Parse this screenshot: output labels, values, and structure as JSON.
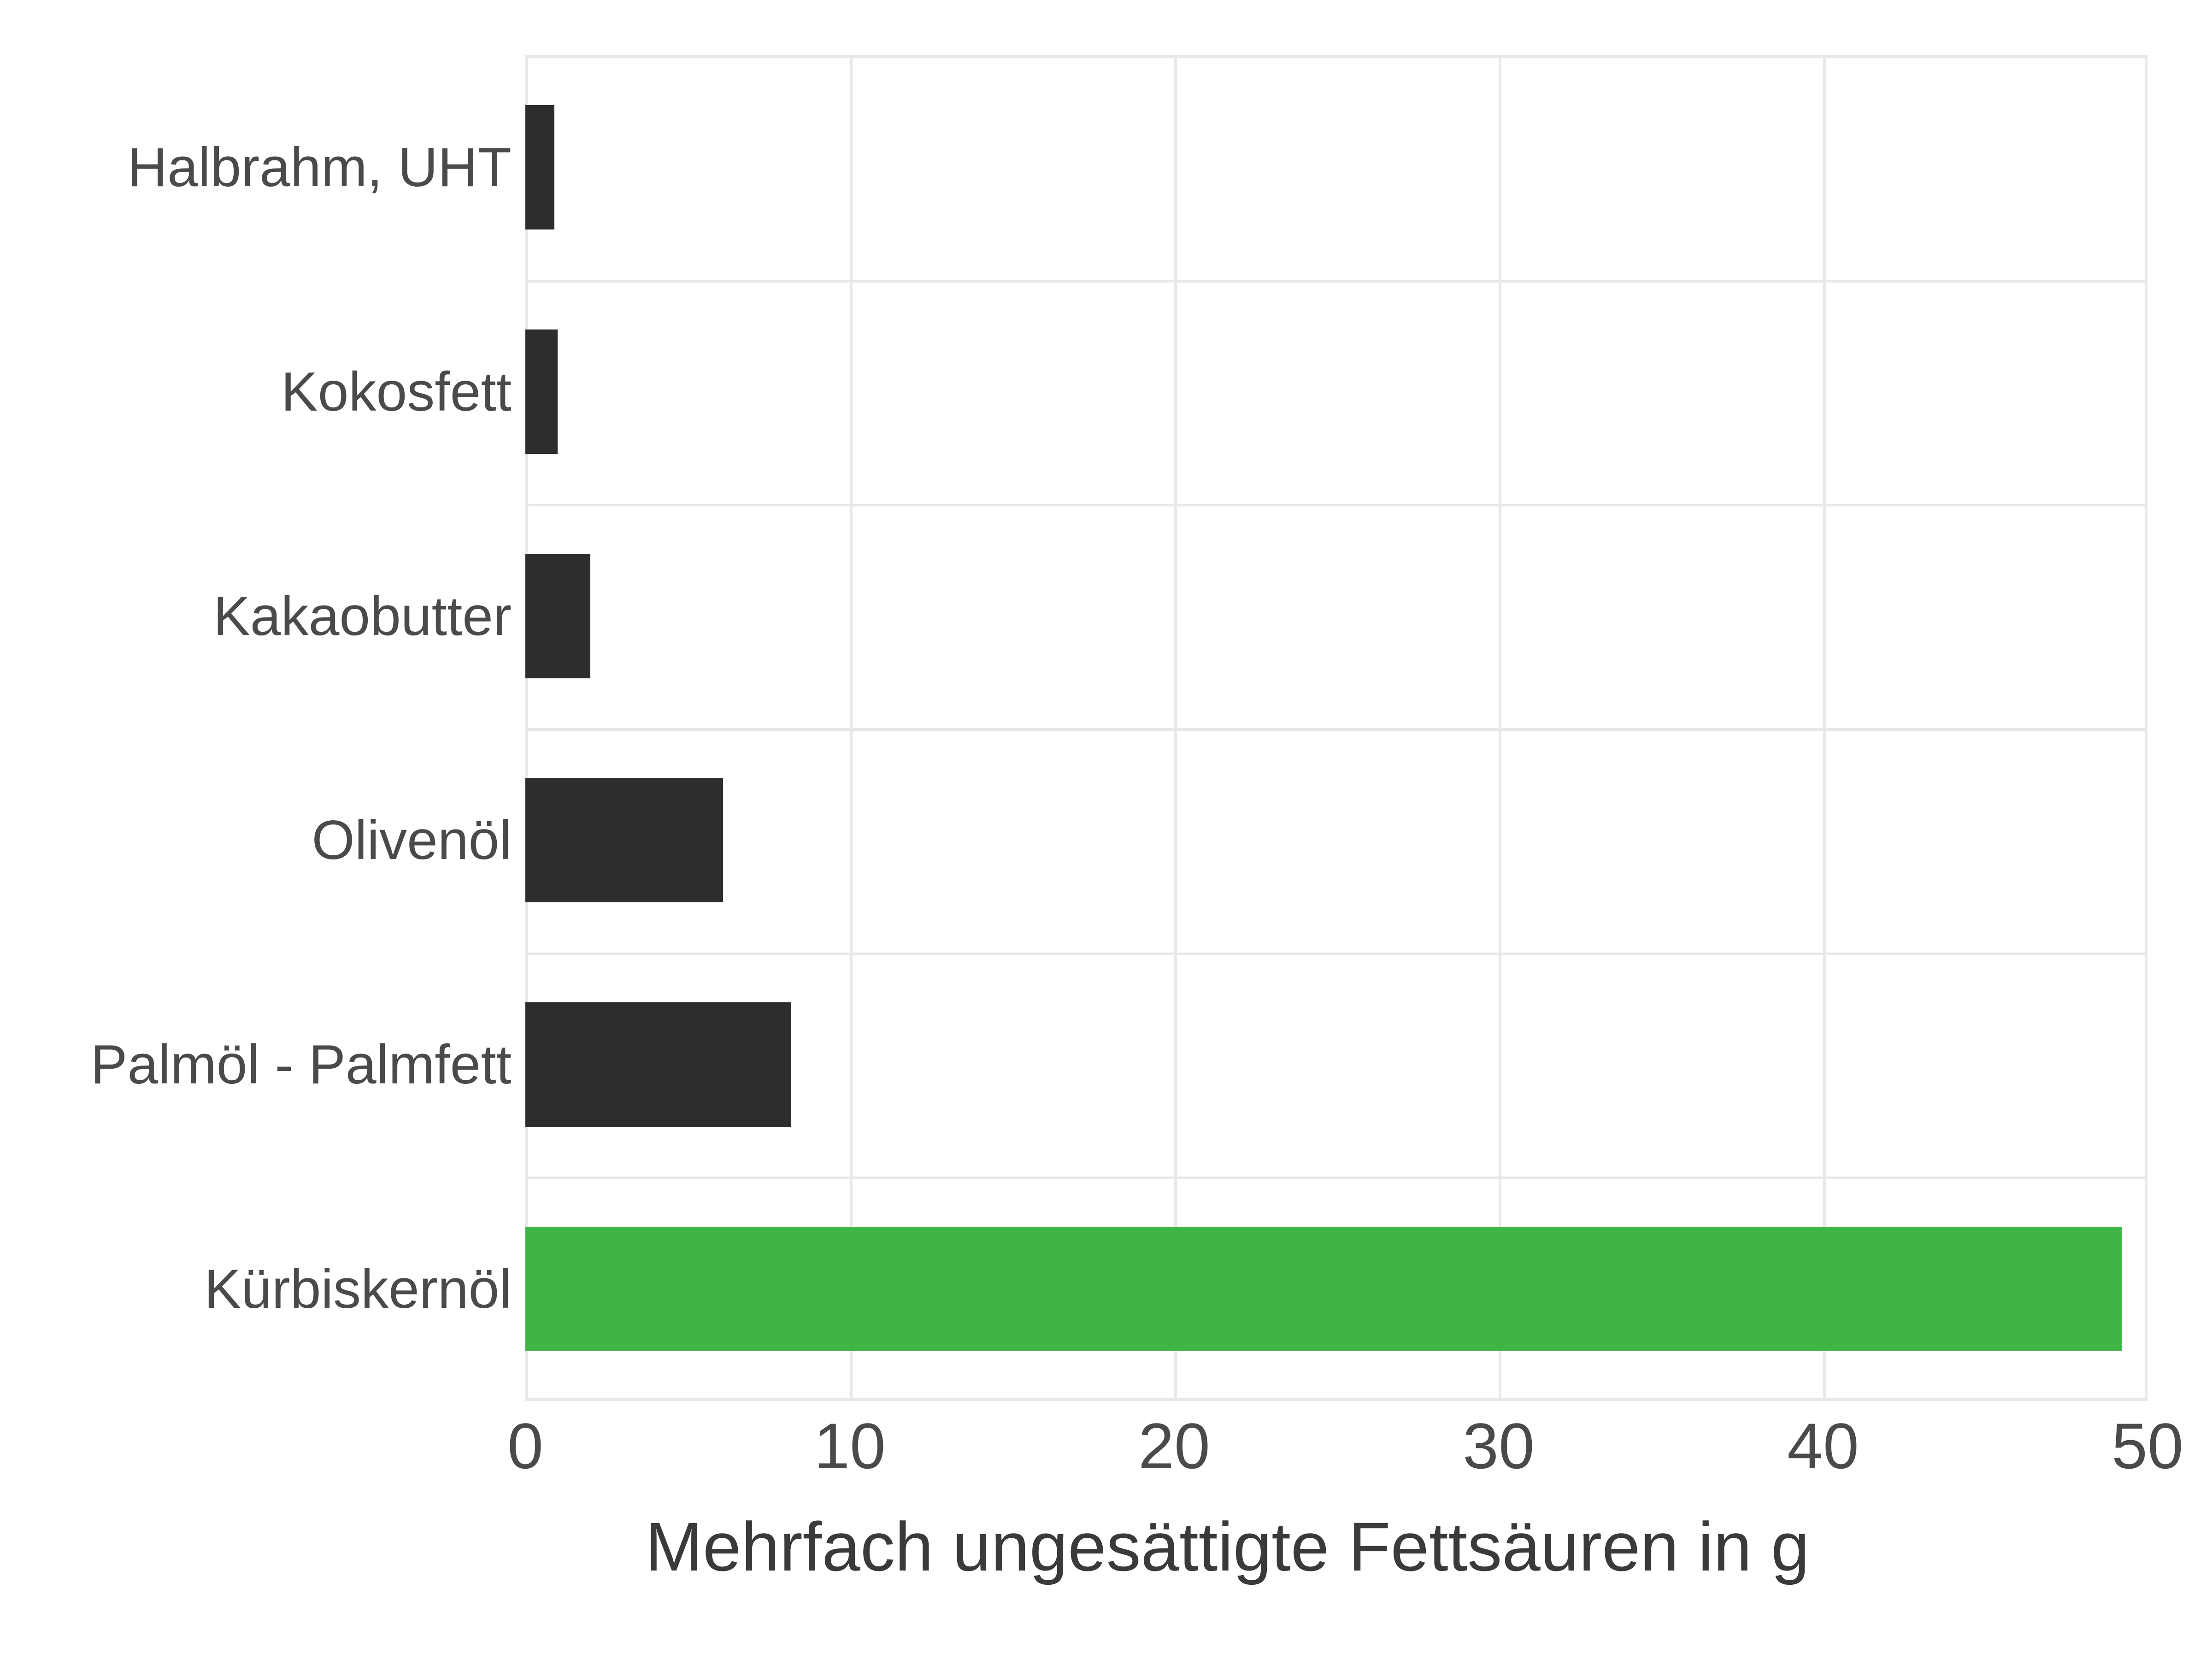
{
  "chart_data": {
    "type": "bar",
    "orientation": "horizontal",
    "categories": [
      "Halbrahm, UHT",
      "Kokosfett",
      "Kakaobutter",
      "Olivenöl",
      "Palmöl - Palmfett",
      "Kürbiskernöl"
    ],
    "values": [
      0.9,
      1.0,
      2.0,
      6.1,
      8.2,
      49.2
    ],
    "highlight_index": 5,
    "xlabel": "Mehrfach ungesättigte Fettsäuren in g",
    "ylabel": "",
    "xlim": [
      0,
      50
    ],
    "x_ticks": [
      0,
      10,
      20,
      30,
      40,
      50
    ],
    "colors": {
      "bar": "#2d2d2d",
      "highlight": "#3fb548",
      "grid": "#e8e8e8",
      "text": "#4a4a4a"
    }
  }
}
